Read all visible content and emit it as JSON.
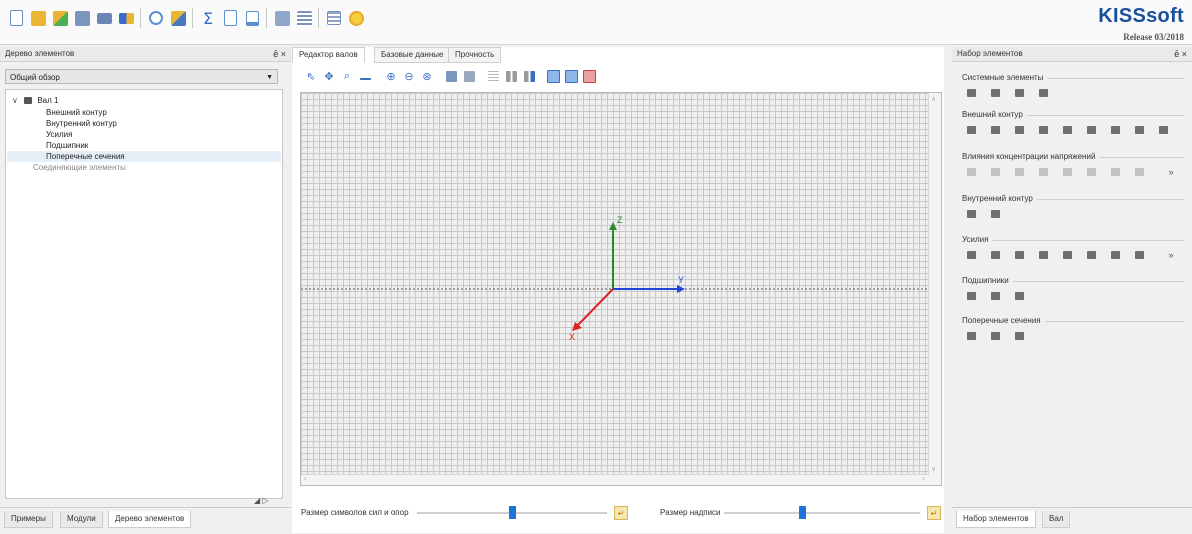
{
  "toolbar": {
    "icons": [
      "new-file-icon",
      "open-folder-icon",
      "open-example-icon",
      "save-icon",
      "send-mail-icon",
      "language-icon",
      "undo-icon",
      "module-open-icon",
      "calculate-sum-icon",
      "report-icon",
      "report-view-icon",
      "drawing-icon",
      "drawing-list-icon",
      "table-icon",
      "wizard-icon"
    ],
    "colors": {
      "accent": "#1a4f9c"
    }
  },
  "brand": {
    "name": "KISSsoft",
    "release": "Release 03/2018"
  },
  "left_panel": {
    "title": "Дерево элементов",
    "controls": "ē ×",
    "view_select": "Общий обзор",
    "tree": {
      "root": "Вал 1",
      "children": [
        "Внешний контур",
        "Внутренний контур",
        "Усилия",
        "Подшипник",
        "Поперечные сечения"
      ],
      "selected": "Поперечные сечения",
      "connecting": "Соединяющие элементы"
    },
    "nav_arrows": "◢ ▷",
    "bottom_tabs": [
      "Примеры",
      "Модули",
      "Дерево элементов"
    ],
    "active_bottom_tab": "Дерево элементов"
  },
  "center": {
    "tabs": [
      "Редактор валов",
      "Базовые данные",
      "Прочность"
    ],
    "active_tab": "Редактор валов",
    "axes": {
      "z": "Z",
      "y": "Y",
      "x": "X"
    },
    "axis_colors": {
      "z": "#2a8a2a",
      "y": "#2244dd",
      "x": "#dd2222"
    },
    "slider1_label": "Размер символов сил и опор",
    "slider1_value": 0.5,
    "slider2_label": "Размер надписи",
    "slider2_value": 0.5
  },
  "right_panel": {
    "title": "Набор элементов",
    "controls": "ē ×",
    "sections": [
      {
        "name": "Системные элементы",
        "icons": 4,
        "more": false,
        "dim": false
      },
      {
        "name": "Внешний контур",
        "icons": 9,
        "more": false,
        "dim": false
      },
      {
        "name": "Влияния концентрации напряжений",
        "icons": 8,
        "more": true,
        "dim": true
      },
      {
        "name": "Внутренний контур",
        "icons": 2,
        "more": false,
        "dim": false
      },
      {
        "name": "Усилия",
        "icons": 8,
        "more": true,
        "dim": false
      },
      {
        "name": "Подшипники",
        "icons": 3,
        "more": false,
        "dim": false
      },
      {
        "name": "Поперечные сечения",
        "icons": 3,
        "more": false,
        "dim": false
      }
    ],
    "more_symbol": "»",
    "bottom_tabs": [
      "Набор элементов",
      "Вал"
    ],
    "active_bottom_tab": "Набор элементов"
  }
}
